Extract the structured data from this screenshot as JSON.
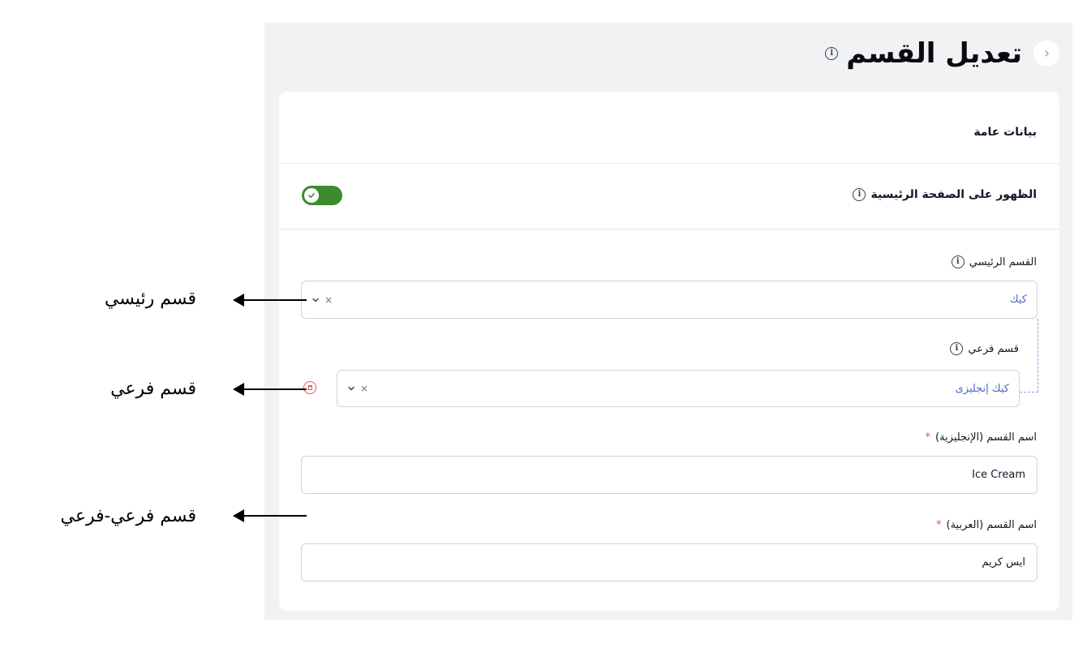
{
  "header": {
    "title": "تعديل القسم",
    "back_icon": "chevron-right-icon",
    "info_icon": "info-icon"
  },
  "general": {
    "section_title": "بيانات عامة",
    "homepage_label": "الظهور على الصفحة الرئيسية",
    "homepage_enabled": true
  },
  "main_category": {
    "label": "القسم الرئيسي",
    "value": "كيك",
    "clear": "×"
  },
  "sub_category": {
    "label": "قسم فرعي",
    "value": "كيك إنجليزى",
    "clear": "×"
  },
  "name_en": {
    "label": "اسم القسم (الإنجليزية)",
    "required": "*",
    "value": "Ice Cream"
  },
  "name_ar": {
    "label": "اسم القسم (العربية)",
    "required": "*",
    "value": "ايس كريم"
  },
  "annotations": {
    "main": "قسم رئيسي",
    "sub": "قسم فرعي",
    "subsub": "قسم فرعي-فرعي"
  },
  "colors": {
    "toggle_on": "#3d8b2f",
    "select_value": "#4a6cc4",
    "required": "#e05a4f",
    "panel_bg": "#f1f2f4"
  }
}
